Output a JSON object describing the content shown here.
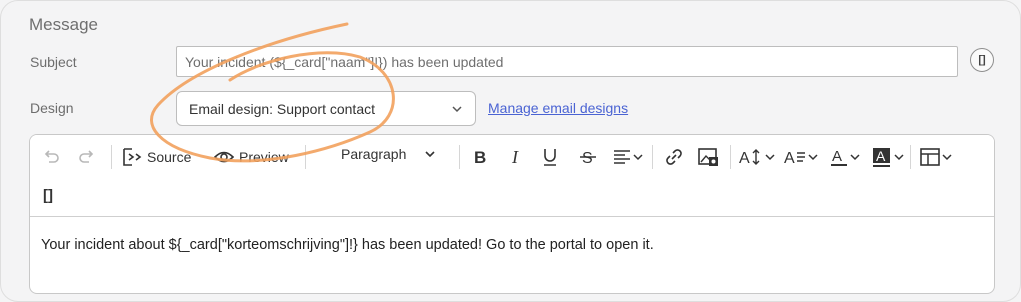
{
  "section_title": "Message",
  "subject": {
    "label": "Subject",
    "value": "Your incident (${_card[\"naam\"]!}) has been updated",
    "variable_button": "[]"
  },
  "design": {
    "label": "Design",
    "selected": "Email design: Support contact",
    "manage_link": "Manage email designs"
  },
  "toolbar": {
    "source_label": "Source",
    "preview_label": "Preview",
    "block_format": "Paragraph",
    "variable_button": "[]"
  },
  "editor": {
    "content": "Your incident about ${_card[\"korteomschrijving\"]!} has been updated! Go to the portal to open it."
  },
  "colors": {
    "accent_link": "#4a63d3",
    "annotation_stroke": "#f2a15d",
    "background": "#f4f4f5"
  }
}
